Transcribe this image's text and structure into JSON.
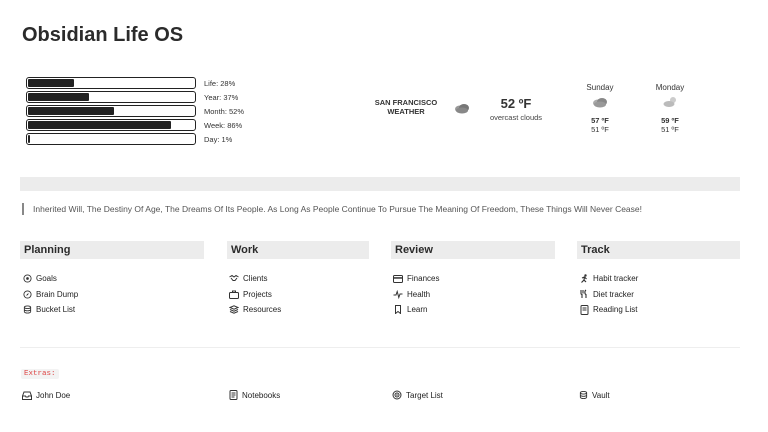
{
  "page": {
    "title": "Obsidian Life OS"
  },
  "progress": [
    {
      "label": "Life: 28%",
      "value": 0.28
    },
    {
      "label": "Year: 37%",
      "value": 0.37
    },
    {
      "label": "Month: 52%",
      "value": 0.52
    },
    {
      "label": "Week: 86%",
      "value": 0.86
    },
    {
      "label": "Day: 1%",
      "value": 0.01
    }
  ],
  "weather": {
    "city": "SAN FRANCISCO",
    "label": "WEATHER",
    "icon": "cloudy-icon",
    "current_temp": "52 ºF",
    "description": "overcast clouds",
    "forecast": [
      {
        "day": "Sunday",
        "icon": "cloudy-icon",
        "high": "57 ºF",
        "low": "51 ºF"
      },
      {
        "day": "Monday",
        "icon": "partly-cloudy-icon",
        "high": "59 ºF",
        "low": "51 ºF"
      }
    ]
  },
  "quote": "Inherited Will, The Destiny Of Age, The Dreams Of Its People. As Long As People Continue To Pursue The Meaning Of Freedom, These Things Will Never Cease!",
  "sections": [
    {
      "title": "Planning",
      "items": [
        {
          "label": "Goals",
          "icon": "target-icon"
        },
        {
          "label": "Brain Dump",
          "icon": "compass-icon"
        },
        {
          "label": "Bucket List",
          "icon": "database-icon"
        }
      ]
    },
    {
      "title": "Work",
      "items": [
        {
          "label": "Clients",
          "icon": "handshake-icon"
        },
        {
          "label": "Projects",
          "icon": "briefcase-icon"
        },
        {
          "label": "Resources",
          "icon": "books-icon"
        }
      ]
    },
    {
      "title": "Review",
      "items": [
        {
          "label": "Finances",
          "icon": "credit-card-icon"
        },
        {
          "label": "Health",
          "icon": "pulse-icon"
        },
        {
          "label": "Learn",
          "icon": "bookmark-icon"
        }
      ]
    },
    {
      "title": "Track",
      "items": [
        {
          "label": "Habit tracker",
          "icon": "runner-icon"
        },
        {
          "label": "Diet tracker",
          "icon": "utensils-icon"
        },
        {
          "label": "Reading List",
          "icon": "book-icon"
        }
      ]
    }
  ],
  "extras": {
    "label": "Extras:",
    "items": [
      {
        "label": "John Doe",
        "icon": "inbox-icon"
      },
      {
        "label": "Notebooks",
        "icon": "notebook-icon"
      },
      {
        "label": "Target List",
        "icon": "target-icon"
      },
      {
        "label": "Vault",
        "icon": "database-icon"
      }
    ]
  }
}
